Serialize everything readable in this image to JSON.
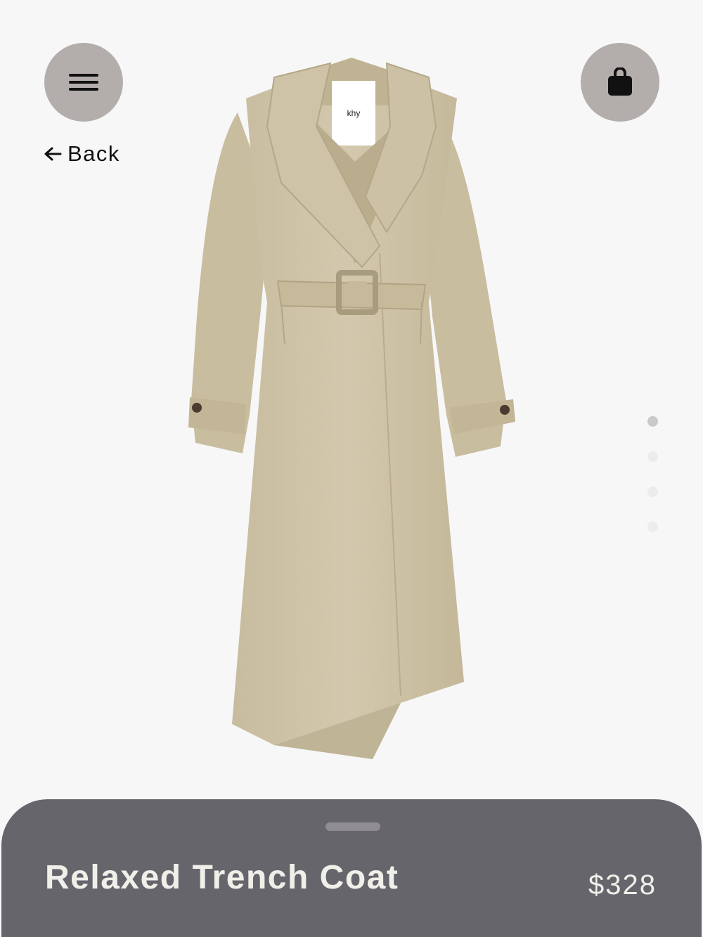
{
  "header": {
    "back_label": "Back",
    "menu_icon": "hamburger-menu-icon",
    "bag_icon": "shopping-bag-icon"
  },
  "product": {
    "title": "Relaxed Trench Coat",
    "price": "$328",
    "label_text": "khy",
    "color": "#cdc1a6"
  },
  "carousel": {
    "total_images": 4,
    "active_index": 0
  },
  "colors": {
    "background": "#f7f7f8",
    "button_bg": "#b3aeac",
    "sheet_bg": "#67656c",
    "sheet_text": "#f1efe9"
  }
}
